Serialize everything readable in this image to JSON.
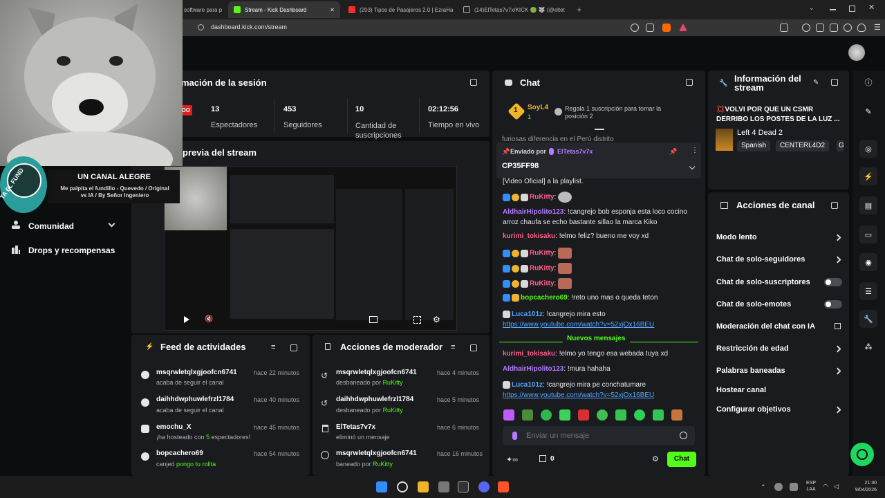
{
  "browser": {
    "tabs": [
      {
        "label": "software para p",
        "active": false
      },
      {
        "label": "Stream - Kick Dashboard",
        "active": true
      },
      {
        "label": "(203) Tipos de Pasajeros 2.0 | EzraHa",
        "active": false
      },
      {
        "label": "(14)ElTetas7v7x/KICK 🟢 🐺 (@eltet",
        "active": false
      }
    ],
    "new_tab": "+",
    "url": "dashboard.kick.com/stream"
  },
  "overlay": {
    "title": "UN CANAL ALEGRE",
    "subtitle": "Me palpita el fundillo - Quevedo / Original vs IA / By Señor Ingeniero",
    "ring_text": "TA EL FUND"
  },
  "left_nav": {
    "items": [
      {
        "label": "Comunidad"
      },
      {
        "label": "Drops y recompensas"
      }
    ]
  },
  "session": {
    "title": "mación de la sesión",
    "live_badge": "DO",
    "stats": [
      {
        "value": "13",
        "label": "Espectadores"
      },
      {
        "value": "453",
        "label": "Seguidores"
      },
      {
        "value": "10",
        "label": "Cantidad de suscripciones"
      },
      {
        "value": "02:12:56",
        "label": "Tiempo en vivo"
      }
    ]
  },
  "preview": {
    "title": "previa del stream"
  },
  "feed": {
    "title": "Feed de actividades",
    "items": [
      {
        "name": "msqrwletqlxgjoofcn6741",
        "sub": "acaba de seguir el canal",
        "time": "hace 22 minutos"
      },
      {
        "name": "daihhdwphuwlefrzl1784",
        "sub": "acaba de seguir el canal",
        "time": "hace 40 minutos"
      },
      {
        "name": "emochu_X",
        "sub_prefix": "¡ha hosteado con ",
        "sub_highlight": "5",
        "sub_suffix": " espectadores!",
        "time": "hace 45 minutos"
      },
      {
        "name": "bopcachero69",
        "sub_prefix": "canjeó ",
        "sub_highlight": "pongo tu rolita",
        "time": "hace 54 minutos"
      }
    ]
  },
  "modactions": {
    "title": "Acciones de moderador",
    "items": [
      {
        "name": "msqrwletqlxgjoofcn6741",
        "sub_prefix": "desbaneado por ",
        "by": "RuKitty",
        "time": "hace 4 minutos"
      },
      {
        "name": "daihhdwphuwlefrzl1784",
        "sub_prefix": "desbaneado por ",
        "by": "RuKitty",
        "time": "hace 5 minutos"
      },
      {
        "name": "ElTetas7v7x",
        "sub_prefix": "eliminó un mensaje",
        "by": "",
        "time": "hace 6 minutos"
      },
      {
        "name": "msqrwletqlxgjoofcn6741",
        "sub_prefix": "baneado por ",
        "by": "RuKitty",
        "time": "hace 16 minutos"
      }
    ]
  },
  "chat": {
    "title": "Chat",
    "sub_gift": {
      "rank": "1",
      "user": "SoyL4",
      "count": "1",
      "msg": "Regala 1 suscripción para tomar la posición 2"
    },
    "truncated": "furiosas diferencia en el Perú distrito",
    "pinned": {
      "label": "Enviado por",
      "user": "ElTetas7v7x",
      "text": "CP35FF98"
    },
    "lines": [
      {
        "user": "",
        "text": "[Video Oficial] a la playlist."
      },
      {
        "user": "RuKitty",
        "text": ""
      },
      {
        "user": "AldhairHipolito123",
        "text": "!cangrejo bob esponja esta loco cocino arroz chaufa se echo bastante sillao la marca Kiko"
      },
      {
        "user": "kurimi_tokisaku",
        "text": "!elmo feliz? bueno me voy xd"
      },
      {
        "user": "RuKitty",
        "text": ""
      },
      {
        "user": "RuKitty",
        "text": ""
      },
      {
        "user": "RuKitty",
        "text": ""
      },
      {
        "user": "bopcachero69",
        "text": "!reto uno mas o queda teton"
      },
      {
        "user": "Luca101z",
        "text": "!cangrejo mira esto",
        "link": "https://www.youtube.com/watch?v=52xjOx16BEU"
      },
      {
        "user": "kurimi_tokisaku",
        "text": "!elmo yo tengo esa webada tuya xd"
      },
      {
        "user": "AldhairHipolito123",
        "text": "!mura hahaha"
      },
      {
        "user": "Luca101z",
        "text": "!cangrejo mira pe conchatumare",
        "link": "https://www.youtube.com/watch?v=52xjOx16BEU"
      }
    ],
    "new_messages": "Nuevos mensajes",
    "input_placeholder": "Enviar un mensaje",
    "points": "0",
    "send_label": "Chat"
  },
  "stream_info": {
    "title": "Información del stream",
    "stream_title": "💢VOLVI POR QUE UN CSMR DERRIBO LOS POSTES DE LA LUZ ...",
    "game": "Left 4 Dead 2",
    "tags": [
      "Spanish",
      "CENTERL4D2",
      "G"
    ]
  },
  "channel_actions": {
    "title": "Acciones de canal",
    "items": [
      {
        "label": "Modo lento",
        "control": "chevron"
      },
      {
        "label": "Chat de solo-seguidores",
        "control": "chevron"
      },
      {
        "label": "Chat de solo-suscriptores",
        "control": "toggle"
      },
      {
        "label": "Chat de solo-emotes",
        "control": "toggle"
      },
      {
        "label": "Moderación del chat con IA",
        "control": "external"
      },
      {
        "label": "Restricción de edad",
        "control": "chevron"
      },
      {
        "label": "Palabras baneadas",
        "control": "chevron"
      },
      {
        "label": "Hostear canal",
        "control": "none"
      },
      {
        "label": "Configurar objetivos",
        "control": "chevron"
      }
    ]
  },
  "taskbar": {
    "lang": "ESP",
    "lang2": "LAA",
    "time": "21:30",
    "date": "9/04/2026"
  },
  "colors": {
    "accent": "#53fc18",
    "card": "#191b1f",
    "background": "#0b0e0f"
  }
}
